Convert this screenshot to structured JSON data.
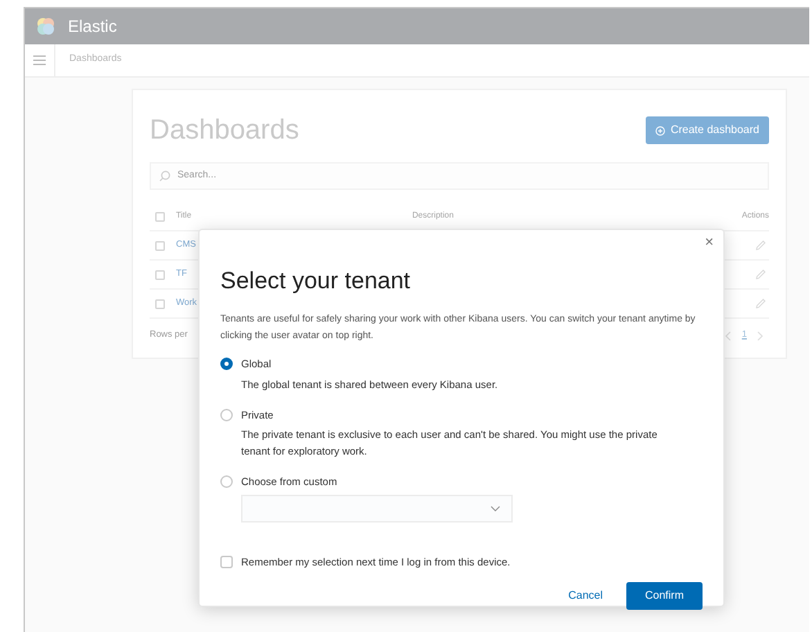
{
  "app_bar": {
    "title": "Elastic"
  },
  "breadcrumb": {
    "items": [
      "Dashboards"
    ]
  },
  "page": {
    "title": "Dashboards",
    "create_button": "Create dashboard",
    "search": {
      "placeholder": "Search..."
    },
    "table": {
      "select_all_checked": false,
      "columns": [
        "Title",
        "Description",
        "Actions"
      ],
      "rows": [
        {
          "title": "CMS",
          "checked": false
        },
        {
          "title": "TF",
          "checked": false
        },
        {
          "title": "Work",
          "checked": false
        }
      ]
    },
    "rows_per_page": "Rows per",
    "pagination": {
      "pages": [
        {
          "label": "1",
          "selected": true
        }
      ]
    }
  },
  "modal": {
    "title": "Select your tenant",
    "close": "×",
    "description": "Tenants are useful for safely sharing your work with other Kibana users. You can switch your tenant anytime by clicking the user avatar on top right.",
    "options": [
      {
        "kind": "radio",
        "label": "Global",
        "description": "The global tenant is shared between every Kibana user.",
        "selected": true
      },
      {
        "kind": "radio",
        "label": "Private",
        "description": "The private tenant is exclusive to each user and can't be shared. You might use the private tenant for exploratory work.",
        "selected": false
      },
      {
        "kind": "select",
        "label": "Choose from custom",
        "selected": false
      }
    ],
    "remember": {
      "label": "Remember my selection next time I log in from this device.",
      "checked": false
    },
    "buttons": [
      {
        "kind": "secondary",
        "label": "Cancel"
      },
      {
        "kind": "primary",
        "label": "Confirm"
      }
    ]
  }
}
